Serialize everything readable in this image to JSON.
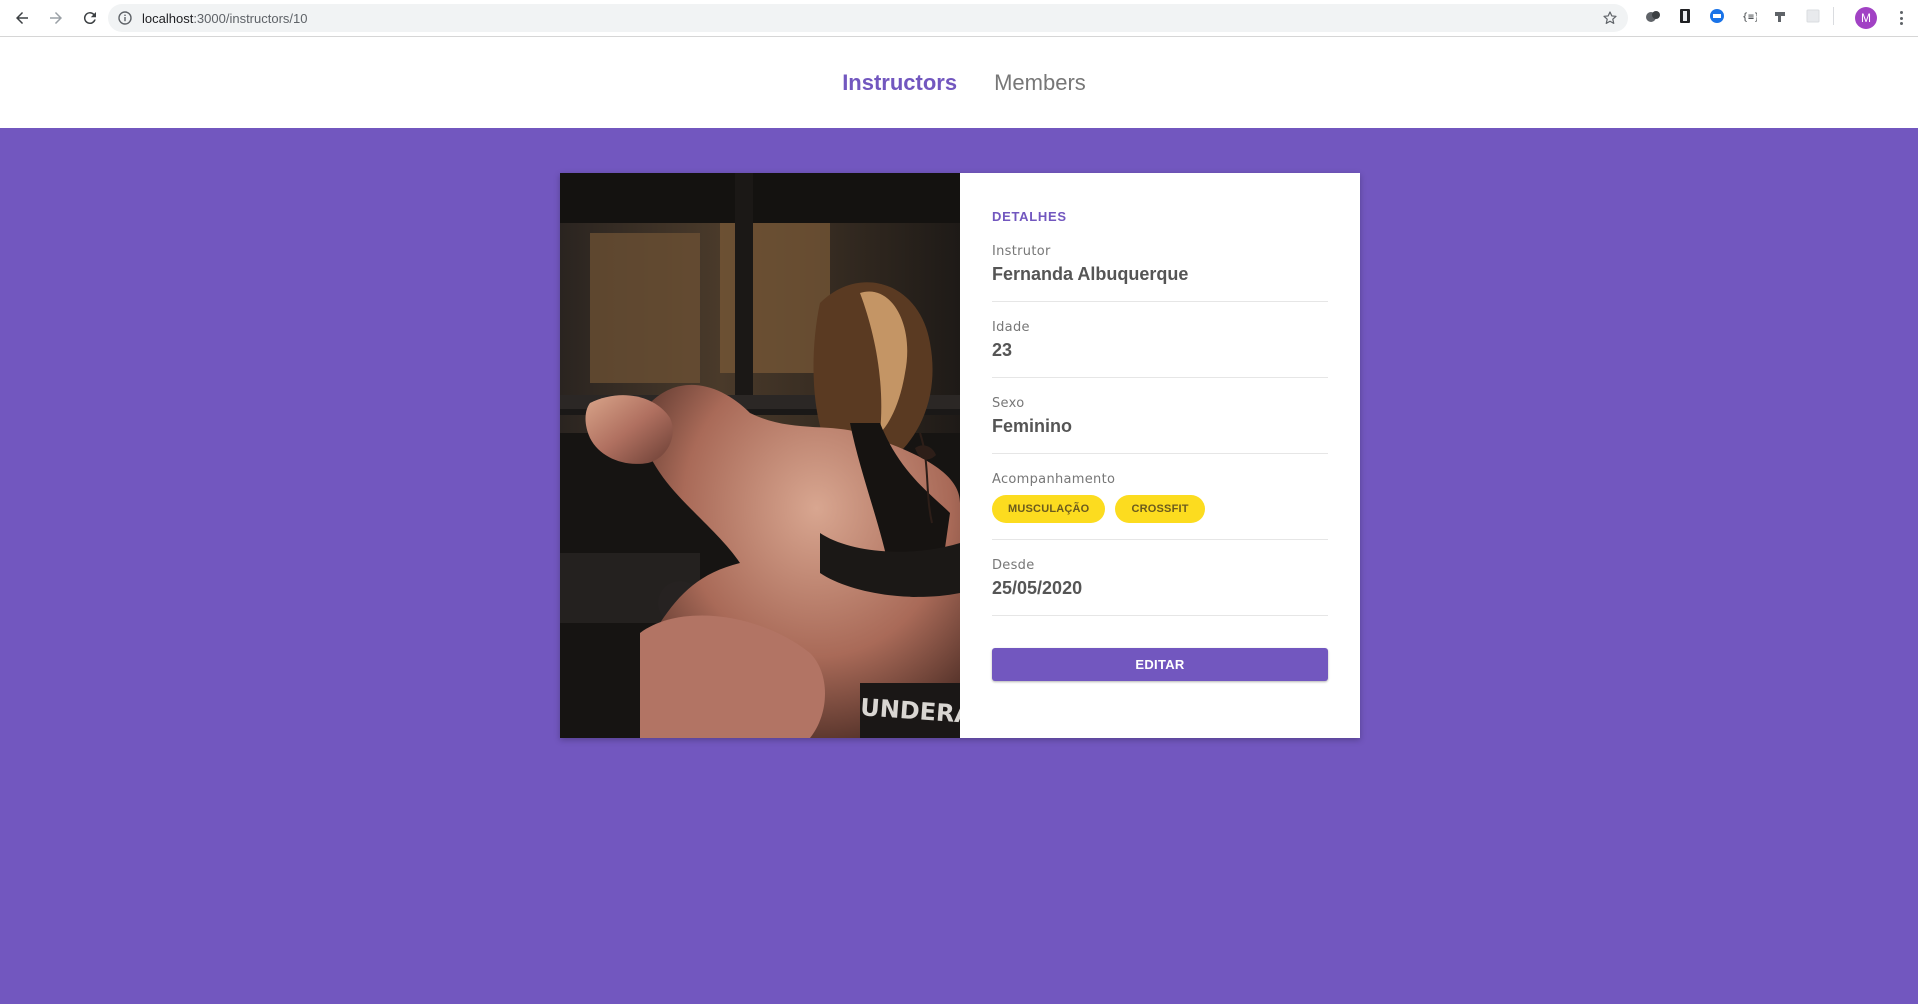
{
  "browser": {
    "url_host": "localhost",
    "url_path": ":3000/instructors/10",
    "avatar_initial": "M"
  },
  "nav": {
    "items": [
      {
        "label": "Instructors",
        "active": true
      },
      {
        "label": "Members",
        "active": false
      }
    ]
  },
  "card": {
    "section_title": "DETALHES",
    "fields": [
      {
        "label": "Instrutor",
        "value": "Fernanda Albuquerque"
      },
      {
        "label": "Idade",
        "value": "23"
      },
      {
        "label": "Sexo",
        "value": "Feminino"
      },
      {
        "label": "Acompanhamento",
        "tags": [
          "MUSCULAÇÃO",
          "CROSSFIT"
        ]
      },
      {
        "label": "Desde",
        "value": "25/05/2020"
      }
    ],
    "edit_label": "EDITAR",
    "photo_text": "UNDERARM"
  },
  "colors": {
    "accent": "#7257bf",
    "tag_bg": "#fcdc1f",
    "tag_text": "#6b5b1e"
  }
}
